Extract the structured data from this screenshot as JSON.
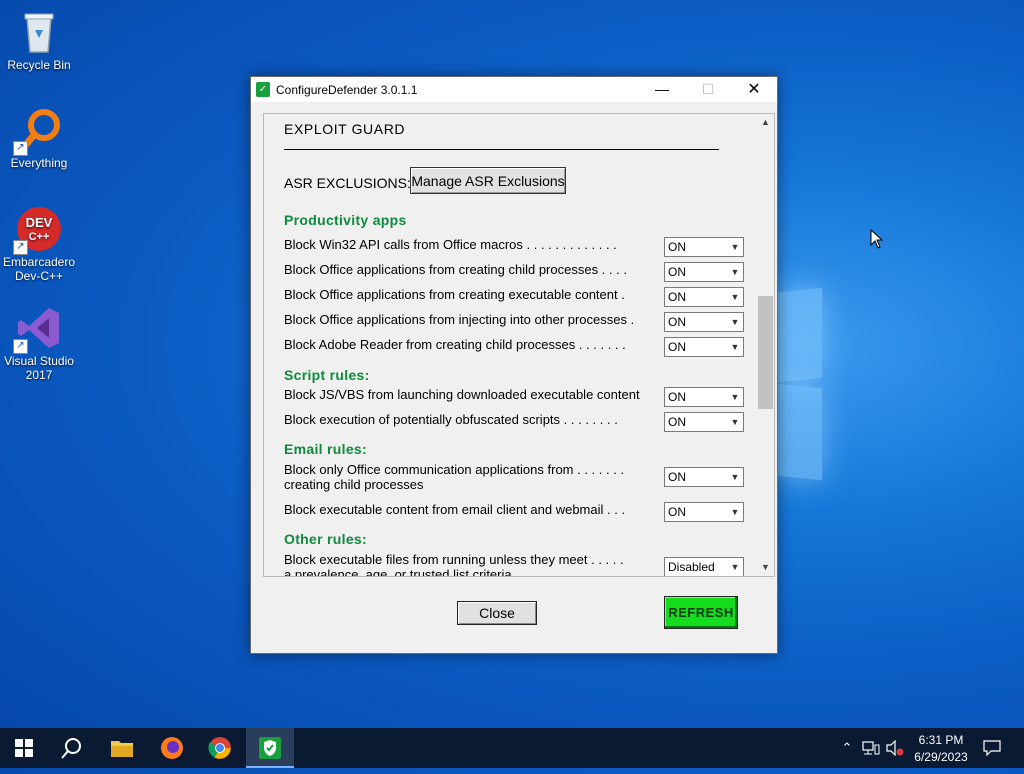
{
  "desktop": {
    "icons": [
      {
        "label": "Recycle Bin",
        "icon": "recycle-bin-icon"
      },
      {
        "label": "Everything",
        "icon": "search-magnifier-icon"
      },
      {
        "label": "Embarcadero Dev-C++",
        "icon": "devcpp-icon"
      },
      {
        "label": "Visual Studio 2017",
        "icon": "visual-studio-icon"
      }
    ]
  },
  "window": {
    "title": "ConfigureDefender 3.0.1.1",
    "minimize": "—",
    "maximize": "☐",
    "close": "✕"
  },
  "panel": {
    "section_title": "EXPLOIT  GUARD",
    "asr_label": "ASR  EXCLUSIONS:",
    "asr_button": "Manage ASR Exclusions",
    "categories": [
      "Productivity apps",
      "Script rules:",
      "Email rules:",
      "Other rules:"
    ],
    "rules": [
      {
        "label": "Block Win32 API calls from Office macros . . . . . . . . . . . . .",
        "value": "ON"
      },
      {
        "label": "Block Office applications from creating child processes . . . .",
        "value": "ON"
      },
      {
        "label": "Block Office applications from creating executable content .",
        "value": "ON"
      },
      {
        "label": "Block Office applications from injecting into other processes .",
        "value": "ON"
      },
      {
        "label": "Block Adobe Reader from creating child processes . . . . . . .",
        "value": "ON"
      },
      {
        "label": "Block JS/VBS from launching downloaded executable content",
        "value": "ON"
      },
      {
        "label": "Block execution of potentially obfuscated scripts . . . . . . . .",
        "value": "ON"
      },
      {
        "label": "Block only Office communication applications from . . . . . . .\ncreating child processes",
        "value": "ON"
      },
      {
        "label": "Block executable content from email client and webmail . . .",
        "value": "ON"
      },
      {
        "label": "Block executable files from running unless they meet . . . . .\na prevalence, age, or trusted list criteria",
        "value": "Disabled"
      }
    ]
  },
  "buttons": {
    "close": "Close",
    "refresh": "REFRESH"
  },
  "taskbar": {
    "time": "6:31 PM",
    "date": "6/29/2023"
  },
  "colors": {
    "category_green": "#0f8a3c",
    "refresh_green": "#16dc1e",
    "desktop_blue": "#0b5cc4"
  }
}
